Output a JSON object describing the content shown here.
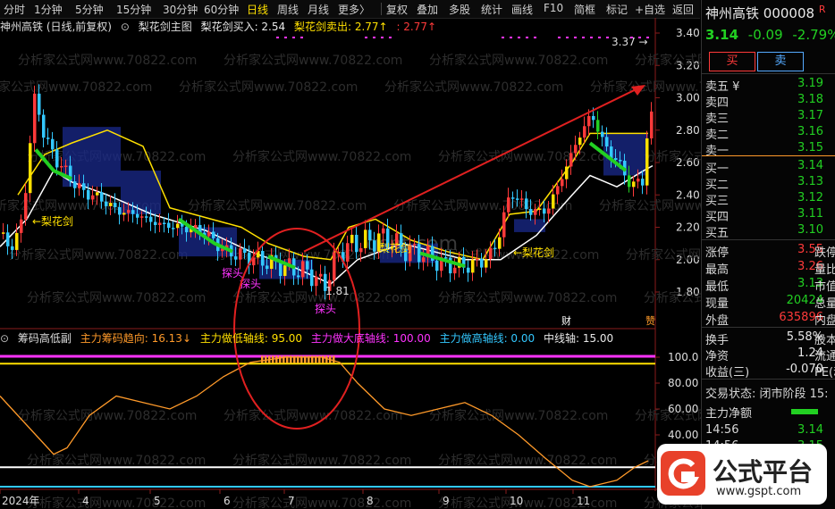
{
  "toolbar": {
    "stock_title": "神州高铁 (日线,前复权)",
    "indicator_name": "梨花剑主图",
    "buy_label": "梨花剑买入: 2.54",
    "sell_label": "梨花剑卖出: 2.77↑",
    "sell_extra": ": 2.77↑",
    "periods": [
      "分时",
      "1分钟",
      "5分钟",
      "15分钟",
      "30分钟",
      "60分钟",
      "日线",
      "周线",
      "月线",
      "更多〉"
    ],
    "tools": [
      "复权",
      "叠加",
      "多股",
      "统计",
      "画线",
      "F10",
      "简框",
      "标记",
      "+自选",
      "返回"
    ]
  },
  "price_axis": [
    "3.40",
    "3.20",
    "3.00",
    "2.80",
    "2.60",
    "2.40",
    "2.20",
    "2.00",
    "1.80"
  ],
  "annotations": {
    "peak": "3.37",
    "low": "1.81",
    "lihuajian": "梨花剑",
    "tantou": "探头",
    "cai": "财",
    "shu": "赞"
  },
  "sub_legend": {
    "name": "筹码高低副",
    "trend": "主力筹码趋向: 16.13↓",
    "low_line": "主力做低轴线: 95.00",
    "bottom_line": "主力做大底轴线: 100.00",
    "high_line": "主力做高轴线: 0.00",
    "mid_line": "中线轴: 15.00"
  },
  "sub_axis": [
    "100.0",
    "80.00",
    "60.00",
    "40.00"
  ],
  "time_axis": [
    "2024年",
    "4",
    "5",
    "6",
    "7",
    "8",
    "9",
    "10",
    "11"
  ],
  "watermark": "分析家公式网www.70822.com",
  "watermark2": "gsbt.com",
  "quote": {
    "name": "神州高铁",
    "code": "000008",
    "badge": "R",
    "price": "3.14",
    "change": "-0.09",
    "pct": "-2.79%",
    "buy_btn": "买",
    "sell_btn": "卖",
    "asks": [
      {
        "label": "卖五 ¥",
        "price": "3.19"
      },
      {
        "label": "卖四",
        "price": "3.18"
      },
      {
        "label": "卖三",
        "price": "3.17"
      },
      {
        "label": "卖二",
        "price": "3.16"
      },
      {
        "label": "卖一",
        "price": "3.15"
      }
    ],
    "bids": [
      {
        "label": "买一",
        "price": "3.14"
      },
      {
        "label": "买二",
        "price": "3.13"
      },
      {
        "label": "买三",
        "price": "3.12"
      },
      {
        "label": "买四",
        "price": "3.11"
      },
      {
        "label": "买五",
        "price": "3.10"
      }
    ],
    "stats": [
      {
        "label": "涨停",
        "value": "3.55",
        "tail": "跌停"
      },
      {
        "label": "最高",
        "value": "3.26",
        "tail": "量比"
      },
      {
        "label": "最低",
        "value": "3.13",
        "tail": "市值"
      },
      {
        "label": "现量",
        "value": "20424",
        "tail": "总量"
      },
      {
        "label": "外盘",
        "value": "635896",
        "tail": "内盘"
      }
    ],
    "fin": [
      {
        "label": "换手",
        "value": "5.58%",
        "tail": "股本"
      },
      {
        "label": "净资",
        "value": "1.24",
        "tail": "流通"
      },
      {
        "label": "收益(三)",
        "value": "-0.070",
        "tail": "PE(动)"
      }
    ],
    "trade_status": "交易状态: 闭市阶段 15:",
    "net_flow": "主力净额",
    "ticks": [
      {
        "time": "14:56",
        "price": "3.14"
      },
      {
        "time": "14:56",
        "price": "3.15"
      }
    ]
  },
  "logo": {
    "main": "公式平台",
    "sub": "www.gspt.com"
  },
  "colors": {
    "up": "#ff3a3a",
    "down": "#22d022",
    "yellow": "#ffe000",
    "magenta": "#ff33ff",
    "navy": "#1a2a8c"
  }
}
